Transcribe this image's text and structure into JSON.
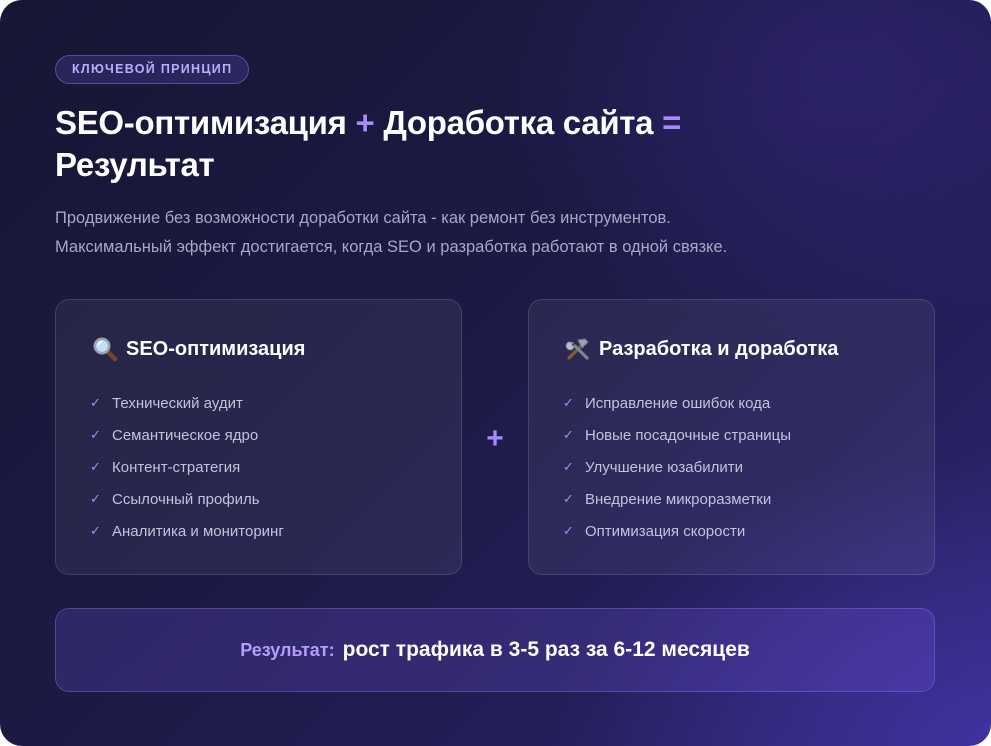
{
  "badge": "КЛЮЧЕВОЙ ПРИНЦИП",
  "title": {
    "part1": "SEO-оптимизация",
    "plus": "+",
    "part2": "Доработка сайта",
    "equals": "=",
    "part3": "Результат"
  },
  "subtitle": {
    "line1": "Продвижение без возможности доработки сайта - как ремонт без инструментов.",
    "line2": "Максимальный эффект достигается, когда SEO и разработка работают в одной связке."
  },
  "seo_panel": {
    "icon": "magnifier-icon",
    "title": "SEO-оптимизация",
    "items": [
      "Технический аудит",
      "Семантическое ядро",
      "Контент-стратегия",
      "Ссылочный профиль",
      "Аналитика и мониторинг"
    ]
  },
  "plus_sign": "+",
  "dev_panel": {
    "icon": "tools-icon",
    "title": "Разработка и доработка",
    "items": [
      "Исправление ошибок кода",
      "Новые посадочные страницы",
      "Улучшение юзабилити",
      "Внедрение микроразметки",
      "Оптимизация скорости"
    ]
  },
  "check_mark": "✓",
  "result": {
    "label": "Результат:",
    "value": "рост трафика в 3-5 раз за 6-12 месяцев"
  },
  "colors": {
    "accent": "#a78bfa",
    "background": "#1c1a44",
    "text": "#ffffff",
    "muted": "#a9a6c7"
  }
}
